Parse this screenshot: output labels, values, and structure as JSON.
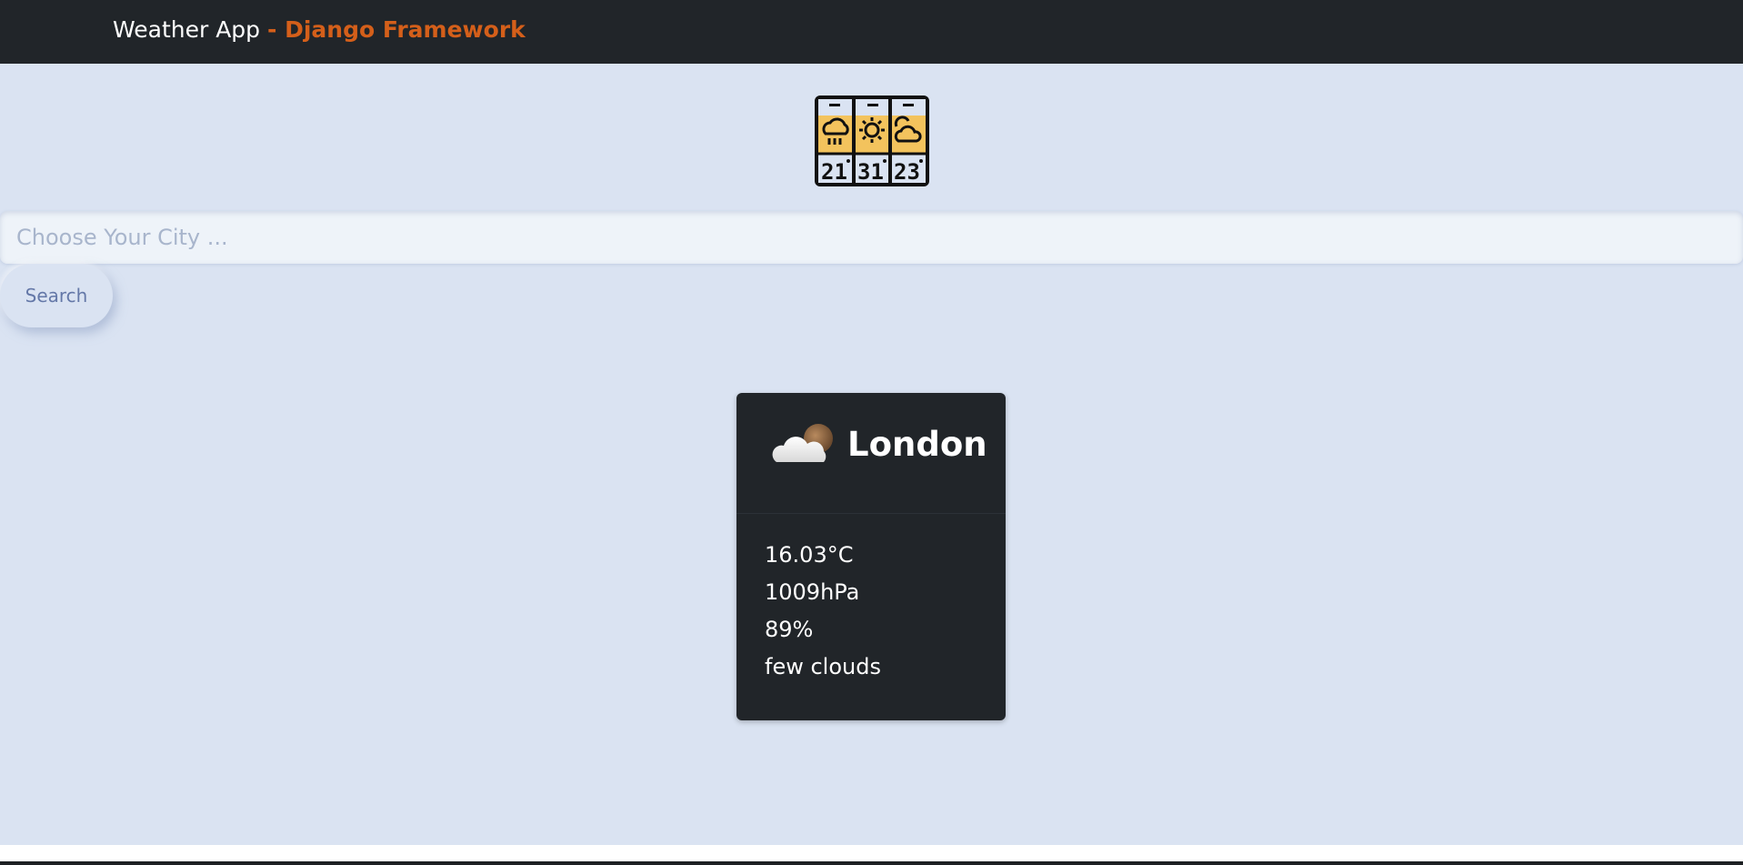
{
  "navbar": {
    "brand_main": "Weather App",
    "brand_accent": "- Django Framework"
  },
  "logo": {
    "icon_name": "weather-forecast-panels-icon",
    "panels": [
      {
        "icon": "rain-cloud-icon",
        "temp": "21"
      },
      {
        "icon": "sun-icon",
        "temp": "31"
      },
      {
        "icon": "cloud-sun-icon",
        "temp": "23"
      }
    ]
  },
  "search": {
    "placeholder": "Choose Your City ...",
    "value": "",
    "button_label": "Search"
  },
  "weather_card": {
    "icon": "few-clouds-icon",
    "city": "London",
    "temperature": "16.03°C",
    "pressure": "1009hPa",
    "humidity": "89%",
    "description": "few clouds"
  },
  "colors": {
    "navbar_bg": "#212529",
    "accent": "#d45f1a",
    "page_bg": "#dae3f2",
    "card_bg": "#212529",
    "panel_yellow": "#f3c35d"
  }
}
